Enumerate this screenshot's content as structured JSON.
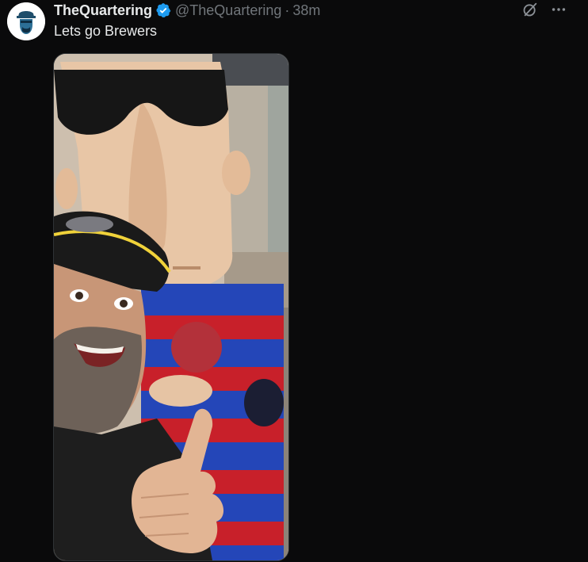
{
  "tweet": {
    "display_name": "TheQuartering",
    "handle": "@TheQuartering",
    "separator": "·",
    "time": "38m",
    "text": "Lets go Brewers"
  },
  "icons": {
    "verified": "verified-badge-icon",
    "grok": "grok-icon",
    "more": "more-options-icon"
  },
  "colors": {
    "background": "#0a0a0b",
    "text": "#e7e9ea",
    "secondary_text": "#71767b",
    "verified": "#1d9bf0"
  }
}
